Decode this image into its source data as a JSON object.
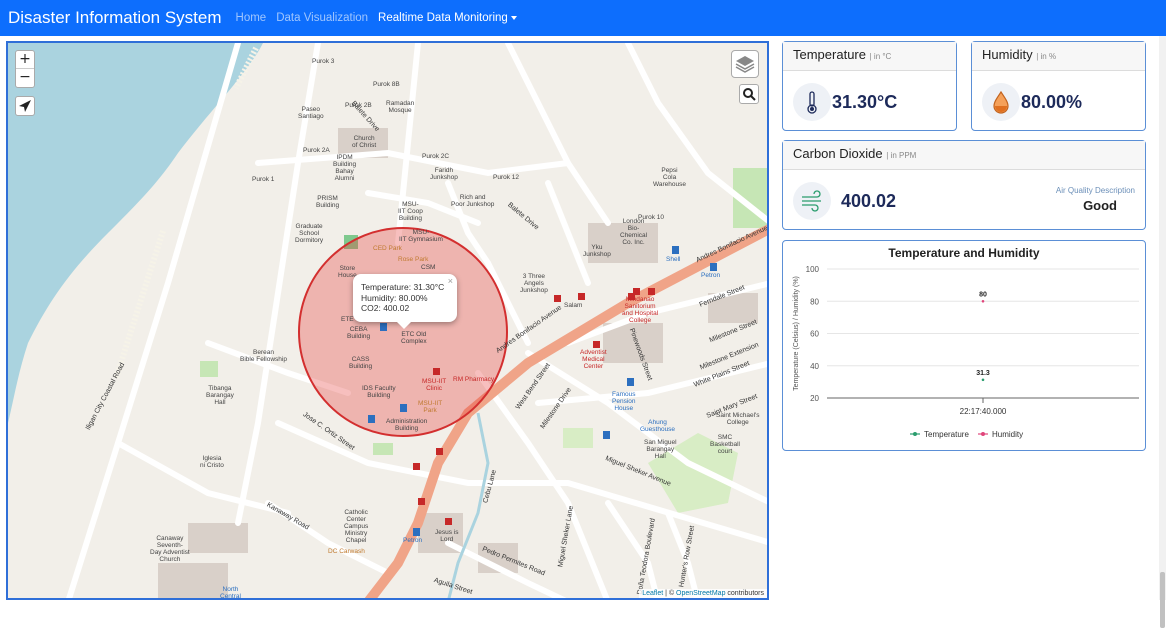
{
  "navbar": {
    "brand": "Disaster Information System",
    "home": "Home",
    "data_visualization": "Data Visualization",
    "realtime": "Realtime Data Monitoring"
  },
  "map": {
    "zoom_in": "+",
    "zoom_out": "−",
    "popup": {
      "close": "×",
      "temperature": "Temperature: 31.30°C",
      "humidity": "Humidity: 80.00%",
      "co2": "CO2: 400.02"
    },
    "attribution": {
      "leaflet": "Leaflet",
      "sep": " | © ",
      "osm": "OpenStreetMap",
      "contributors": " contributors"
    },
    "labels": {
      "purok3": "Purok 3",
      "purok8b": "Purok 8B",
      "purok2b": "Purok 2B",
      "paseo": "Paseo\nSantiago",
      "ramadan": "Ramadan\nMosque",
      "balete1": "Balete Drive",
      "church_christ": "Church\nof Christ",
      "purok2a": "Purok 2A",
      "ipdm": "IPDM\nBuilding\nBahay\nAlumni",
      "purok2c": "Purok 2C",
      "faridh": "Faridh\nJunkshop",
      "purok12": "Purok 12",
      "pepsi": "Pepsi\nCola\nWarehouse",
      "purok1": "Purok 1",
      "prism": "PRISM\nBuilding",
      "msu_coop": "MSU-\nIIT Coop\nBuilding",
      "rich_poor": "Rich and\nPoor Junkshop",
      "balete2": "Balete Drive",
      "london": "London\nBio-\nChemical\nCo. Inc.",
      "purok10": "Purok 10",
      "graduate": "Graduate\nSchool\nDormitory",
      "msu_gym": "MSU-\nIIT Gymnasium",
      "ced_park": "CED Park",
      "yku": "Yku\nJunkshop",
      "shell": "Shell",
      "petron1": "Petron",
      "andres1": "Andres Bonifacio Avenue",
      "store": "Store\nHouse",
      "rose_park": "Rose Park",
      "csm": "CSM",
      "three_angels": "3 Three\nAngels\nJunkshop",
      "salam": "Salam",
      "mindanao_hosp": "Mindanao\nSanitorium\nand Hospital\nCollege",
      "ferndale": "Ferndale Street",
      "ete": "ETE",
      "ceba": "CEBA\nBuilding",
      "etc_old": "ETC Old\nComplex",
      "andres2": "Andres Bonifacio Avenue",
      "milestone_st": "Milestone Street",
      "berean": "Berean\nBible Fellowship",
      "cass": "CASS\nBuilding",
      "adventist_med": "Adventist\nMedical\nCenter",
      "pinewoods": "Pinewoods Street",
      "milestone_ext": "Milestone Extension",
      "white_plains": "White Plains Street",
      "tibanga": "Tibanga\nBarangay\nHall",
      "msu_clinic": "MSU-IIT\nClinic",
      "rm_pharmacy": "RM Pharmacy",
      "ids": "IDS Faculty\nBuilding",
      "msu_park": "MSU-IIT\nPark",
      "famous": "Famous\nPension\nHouse",
      "saint_mary": "Saint Mary Street",
      "west_bend": "West Bend Street",
      "milestone_dr": "Milestone Drive",
      "st_michaels": "Saint Michael's\nCollege",
      "jose_ortiz": "Jose C. Ortiz Street",
      "admin": "Administration\nBuilding",
      "ahung": "Ahung\nGuesthouse",
      "smc": "SMC\nBasketball\ncourt",
      "san_miguel": "San Miguel\nBarangay\nHall",
      "ilign_coastal": "Iligan City Coastal Road",
      "cebu_lane": "Cebu Lane",
      "iglesia": "Iglesia\nni Cristo",
      "miguel_sheker1": "Miguel Sheker Lane",
      "miguel_sheker2": "Miguel Sheker Avenue",
      "catholic": "Catholic\nCenter\nCampus\nMinistry\nChapel",
      "kanaway": "Kanaway Road",
      "jesus_lord": "Jesus is\nLord",
      "petron2": "Petron",
      "canaway": "Canaway\nSeventh-\nDay Adventist\nChurch",
      "dc_carwash": "DC Carwash",
      "pedro": "Pedro Permites Road",
      "aguila": "Aguila Street",
      "dona_teodora": "Doña Teodora Boulevard",
      "hunters": "Hunter's Row Street",
      "north_central": "North\nCentral"
    }
  },
  "temperature_card": {
    "title": "Temperature",
    "unit": "| in °C",
    "value": "31.30°C",
    "icon": "thermometer-icon"
  },
  "humidity_card": {
    "title": "Humidity",
    "unit": "| in %",
    "value": "80.00%",
    "icon": "droplet-icon"
  },
  "co2_card": {
    "title": "Carbon Dioxide",
    "unit": "| in PPM",
    "value": "400.02",
    "aq_label": "Air Quality Description",
    "aq_value": "Good",
    "icon": "wind-icon"
  },
  "colors": {
    "navbar": "#0d6efd",
    "circle": "#e53935",
    "temperature_series": "#2a9d6e",
    "humidity_series": "#e0457b"
  },
  "chart_data": {
    "type": "line",
    "title": "Temperature and Humidity",
    "ylabel": "Temperature (Celsius) / Humidity (%)",
    "xlabel": "",
    "ylim": [
      20,
      100
    ],
    "yticks": [
      20,
      40,
      60,
      80,
      100
    ],
    "categories": [
      "22:17:40.000"
    ],
    "series": [
      {
        "name": "Temperature",
        "values": [
          31.3
        ],
        "color": "#2a9d6e"
      },
      {
        "name": "Humidity",
        "values": [
          80
        ],
        "color": "#e0457b"
      }
    ],
    "data_labels": [
      "31.3",
      "80"
    ],
    "legend_position": "bottom",
    "grid": true
  }
}
